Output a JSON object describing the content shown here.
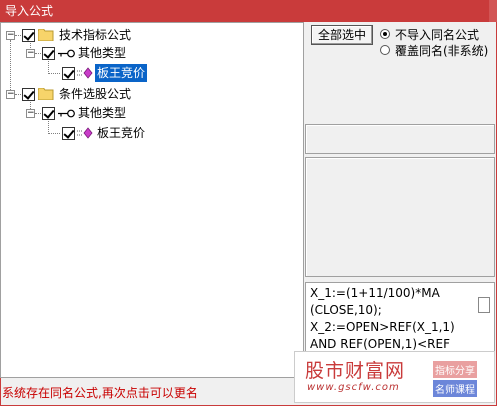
{
  "window": {
    "title": "导入公式"
  },
  "tree": {
    "nodes": [
      {
        "label": "技术指标公式",
        "expander": "−"
      },
      {
        "label": "其他类型",
        "expander": "−"
      },
      {
        "label": "板王竞价"
      },
      {
        "label": "条件选股公式",
        "expander": "−"
      },
      {
        "label": "其他类型",
        "expander": "−"
      },
      {
        "label": "板王竞价"
      }
    ]
  },
  "options": {
    "select_all_label": "全部选中",
    "radio_skip_label": "不导入同名公式",
    "radio_overwrite_label": "覆盖同名(非系统)",
    "selected": "skip"
  },
  "code": {
    "lines": [
      "X_1:=(1+11/100)*MA",
      "(CLOSE,10);",
      "X_2:=OPEN>REF(X_1,1)",
      "AND REF(OPEN,1)<REF"
    ]
  },
  "watermark": {
    "logo": "股市财富网",
    "url": "www.gscfw.com",
    "tag1": "指标分享",
    "tag2": "名师课程"
  },
  "status": {
    "message": "系统存在同名公式,再次点击可以更名"
  },
  "colors": {
    "accent": "#c93b3b",
    "selection": "#0a64c8",
    "status": "#c80000"
  }
}
